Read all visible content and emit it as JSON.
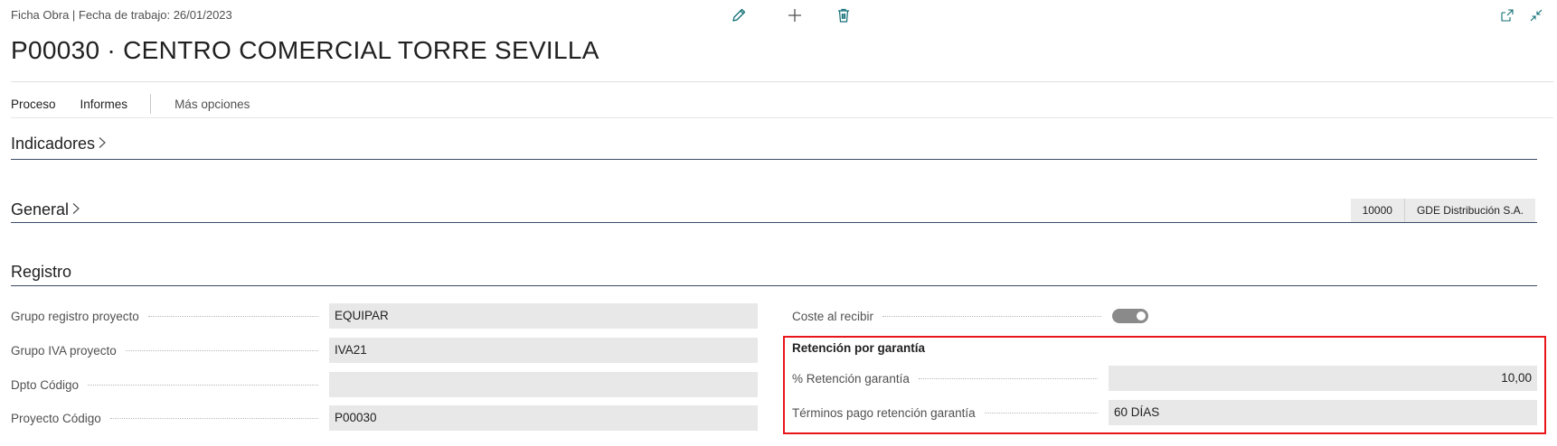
{
  "header": {
    "breadcrumb": "Ficha Obra | Fecha de trabajo: 26/01/2023",
    "title": "P00030 · CENTRO COMERCIAL TORRE SEVILLA",
    "icons": [
      "edit-icon",
      "add-icon",
      "delete-icon",
      "open-new-window-icon",
      "collapse-icon"
    ]
  },
  "actionbar": {
    "proceso": "Proceso",
    "informes": "Informes",
    "mas_opciones": "Más opciones"
  },
  "sections": {
    "indicadores": "Indicadores",
    "general": "General",
    "registro": "Registro"
  },
  "general_summary": {
    "customer_no": "10000",
    "customer_name": "GDE Distribución S.A."
  },
  "registro": {
    "left": [
      {
        "label": "Grupo registro proyecto",
        "value": "EQUIPAR"
      },
      {
        "label": "Grupo IVA proyecto",
        "value": "IVA21"
      },
      {
        "label": "Dpto Código",
        "value": ""
      },
      {
        "label": "Proyecto Código",
        "value": "P00030"
      }
    ],
    "coste_al_recibir": {
      "label": "Coste al recibir",
      "enabled": true
    },
    "retencion": {
      "title": "Retención por garantía",
      "porcentaje": {
        "label": "% Retención garantía",
        "value": "10,00"
      },
      "terminos": {
        "label": "Términos pago retención garantía",
        "value": "60 DÍAS"
      }
    }
  },
  "colors": {
    "accent": "#0f6e74",
    "highlight": "#e8161b",
    "section_rule": "#3b4a64"
  }
}
